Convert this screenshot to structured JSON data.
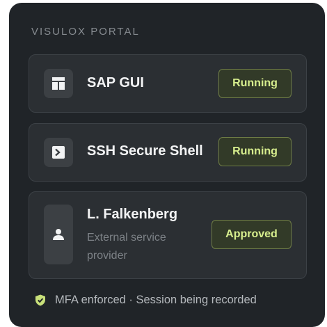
{
  "portal": {
    "title": "VISULOX PORTAL"
  },
  "apps": [
    {
      "name": "SAP GUI",
      "status": "Running",
      "icon": "window-layout-icon"
    },
    {
      "name": "SSH Secure Shell",
      "status": "Running",
      "icon": "terminal-icon"
    }
  ],
  "approval": {
    "name": "L. Falkenberg",
    "subtitle": "External service provider",
    "status": "Approved",
    "icon": "user-icon"
  },
  "footer": {
    "text": "MFA enforced · Session being recorded",
    "icon": "shield-check-icon"
  },
  "colors": {
    "panel_bg": "#202428",
    "card_bg": "#2b2f33",
    "badge_text": "#d7ee8e",
    "badge_border": "#6f7d46",
    "shield": "#c8e07a"
  }
}
